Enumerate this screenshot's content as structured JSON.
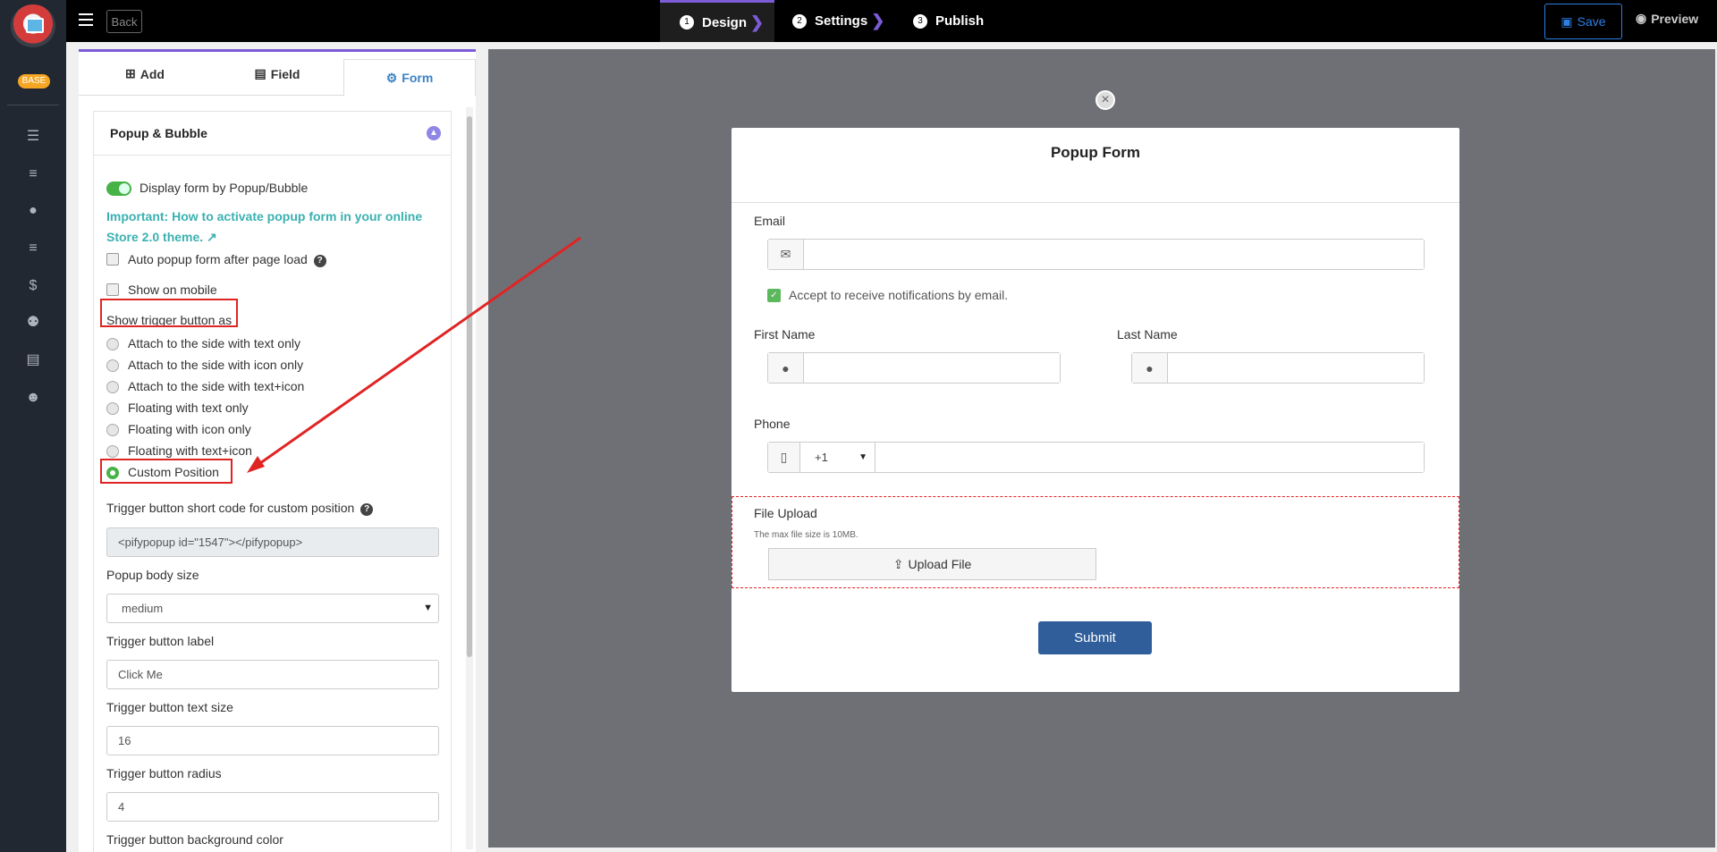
{
  "rail": {
    "badge": "BASE",
    "icons": [
      "list-icon",
      "menu-icon",
      "user-icon",
      "bars-icon",
      "dollar-icon",
      "users-icon",
      "file-icon",
      "smile-icon"
    ]
  },
  "topbar": {
    "back_label": "Back",
    "steps": [
      {
        "num": "1",
        "label": "Design"
      },
      {
        "num": "2",
        "label": "Settings"
      },
      {
        "num": "3",
        "label": "Publish"
      }
    ],
    "save_label": "Save",
    "preview_label": "Preview"
  },
  "tabs": {
    "add": "Add",
    "field": "Field",
    "form": "Form"
  },
  "section": {
    "title": "Popup & Bubble",
    "display_toggle_label": "Display form by Popup/Bubble",
    "important_link": "Important: How to activate popup form in your online Store 2.0 theme.",
    "auto_popup_label": "Auto popup form after page load",
    "show_mobile_label": "Show on mobile",
    "trigger_heading": "Show trigger button as",
    "trigger_options": [
      "Attach to the side with text only",
      "Attach to the side with icon only",
      "Attach to the side with text+icon",
      "Floating with text only",
      "Floating with icon only",
      "Floating with text+icon",
      "Custom Position"
    ],
    "selected_option": "Custom Position",
    "shortcode_label": "Trigger button short code for custom position",
    "shortcode_value": "<pifypopup id=\"1547\"></pifypopup>",
    "body_size_label": "Popup body size",
    "body_size_value": "medium",
    "btn_label_label": "Trigger button label",
    "btn_label_value": "Click Me",
    "text_size_label": "Trigger button text size",
    "text_size_value": "16",
    "radius_label": "Trigger button radius",
    "radius_value": "4",
    "bg_color_label": "Trigger button background color"
  },
  "form": {
    "title": "Popup Form",
    "email_label": "Email",
    "accept_label": "Accept to receive notifications by email.",
    "first_name_label": "First Name",
    "last_name_label": "Last Name",
    "phone_label": "Phone",
    "phone_code": "+1",
    "file_upload_label": "File Upload",
    "file_hint": "The max file size is 10MB.",
    "upload_btn": "Upload File",
    "submit_label": "Submit"
  },
  "colors": {
    "accent": "#7b5cd6",
    "link": "#3bb0b0",
    "toggle_on": "#47b347",
    "highlight": "#e02424",
    "submit": "#2f5e9a",
    "save": "#2d7fe3"
  }
}
